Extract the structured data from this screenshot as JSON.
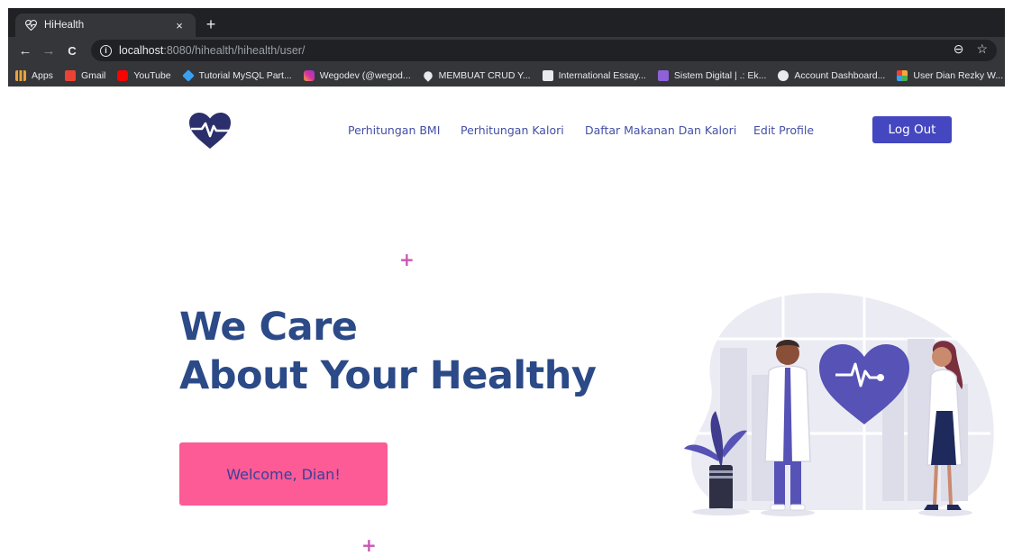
{
  "browser": {
    "tab_title": "HiHealth",
    "tab_close": "×",
    "new_tab": "+",
    "url_host": "localhost",
    "url_rest": ":8080/hihealth/hihealth/user/",
    "back": "←",
    "forward": "→",
    "reload": "C",
    "zoom_icon": "⊖",
    "star_icon": "☆"
  },
  "bookmarks": [
    {
      "label": "Apps",
      "icon": "apps-icon",
      "color": "#e9a23b"
    },
    {
      "label": "Gmail",
      "icon": "gmail-icon",
      "color": "#ea4335"
    },
    {
      "label": "YouTube",
      "icon": "youtube-icon",
      "color": "#ff0000"
    },
    {
      "label": "Tutorial MySQL Part...",
      "icon": "code-icon",
      "color": "#3aa0f0"
    },
    {
      "label": "Wegodev (@wegod...",
      "icon": "instagram-icon",
      "color": "#d6339b"
    },
    {
      "label": "MEMBUAT CRUD Y...",
      "icon": "pin-icon",
      "color": "#e8eaed"
    },
    {
      "label": "International Essay...",
      "icon": "doc-icon",
      "color": "#e8eaed"
    },
    {
      "label": "Sistem Digital | .: Ek...",
      "icon": "puzzle-icon",
      "color": "#8e61d8"
    },
    {
      "label": "Account Dashboard...",
      "icon": "globe-icon",
      "color": "#e8eaed"
    },
    {
      "label": "User Dian Rezky W...",
      "icon": "grid-icon",
      "color": "#f2a93b"
    }
  ],
  "nav": {
    "bmi": "Perhitungan BMI",
    "kalori": "Perhitungan Kalori",
    "daftar": "Daftar Makanan Dan Kalori",
    "edit": "Edit Profile",
    "logout": "Log Out"
  },
  "hero": {
    "line1": "We Care",
    "line2": "About Your Healthy",
    "welcome": "Welcome, Dian!"
  },
  "decor": {
    "plus": "+"
  },
  "colors": {
    "brand": "#4547c0",
    "heading": "#2b4a87",
    "accent_pink": "#fc5b96",
    "plus": "#c757b4"
  }
}
